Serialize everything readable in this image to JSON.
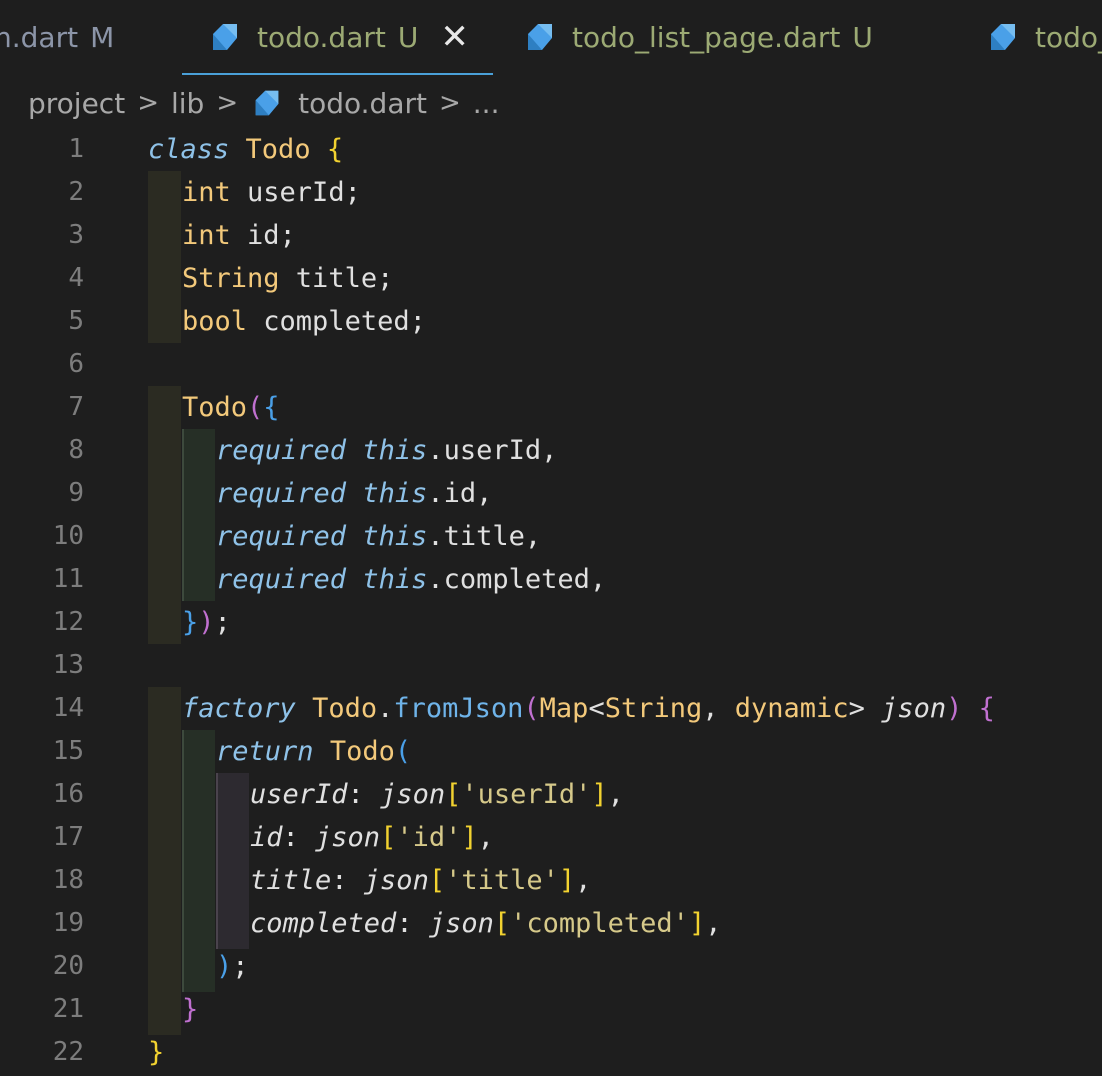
{
  "tabs": [
    {
      "name": "n.dart",
      "status": "M"
    },
    {
      "name": "todo.dart",
      "status": "U",
      "active": true
    },
    {
      "name": "todo_list_page.dart",
      "status": "U"
    },
    {
      "name": "todo_",
      "status": ""
    }
  ],
  "breadcrumb": [
    "project",
    "lib",
    "todo.dart",
    "..."
  ],
  "line_numbers": [
    "1",
    "2",
    "3",
    "4",
    "5",
    "6",
    "7",
    "8",
    "9",
    "10",
    "11",
    "12",
    "13",
    "14",
    "15",
    "16",
    "17",
    "18",
    "19",
    "20",
    "21",
    "22"
  ],
  "code": {
    "l1": {
      "kw": "class",
      "name": "Todo",
      "br": "{"
    },
    "l2": {
      "type": "int",
      "rest": " userId;"
    },
    "l3": {
      "type": "int",
      "rest": " id;"
    },
    "l4": {
      "type": "String",
      "rest": " title;"
    },
    "l5": {
      "type": "bool",
      "rest": " completed;"
    },
    "l7": {
      "name": "Todo",
      "p": "(",
      "b": "{"
    },
    "l8": {
      "kw": "required",
      "this": "this",
      "rest": ".userId,"
    },
    "l9": {
      "kw": "required",
      "this": "this",
      "rest": ".id,"
    },
    "l10": {
      "kw": "required",
      "this": "this",
      "rest": ".title,"
    },
    "l11": {
      "kw": "required",
      "this": "this",
      "rest": ".completed,"
    },
    "l12": {
      "b": "}",
      "p": ")",
      "end": ";"
    },
    "l14": {
      "kw": "factory",
      "name": "Todo",
      "dot": ".",
      "fn": "fromJson",
      "p": "(",
      "type1": "Map",
      "lt": "<",
      "type2": "String",
      "comma": ", ",
      "type3": "dynamic",
      "gt": ">",
      "param": " json",
      "pc": ")",
      "b": "{"
    },
    "l15": {
      "kw": "return",
      "name": "Todo",
      "p": "("
    },
    "l16": {
      "key": "userId",
      "colon": ": ",
      "json": "json",
      "ob": "[",
      "str": "'userId'",
      "cb": "]",
      "end": ","
    },
    "l17": {
      "key": "id",
      "colon": ": ",
      "json": "json",
      "ob": "[",
      "str": "'id'",
      "cb": "]",
      "end": ","
    },
    "l18": {
      "key": "title",
      "colon": ": ",
      "json": "json",
      "ob": "[",
      "str": "'title'",
      "cb": "]",
      "end": ","
    },
    "l19": {
      "key": "completed",
      "colon": ": ",
      "json": "json",
      "ob": "[",
      "str": "'completed'",
      "cb": "]",
      "end": ","
    },
    "l20": {
      "p": ")",
      "end": ";"
    },
    "l21": {
      "b": "}"
    },
    "l22": {
      "b": "}"
    }
  },
  "colors": {
    "background": "#1e1e1e",
    "tab_active_border": "#4aa0d8",
    "dart_icon": "#4aa0e8"
  }
}
